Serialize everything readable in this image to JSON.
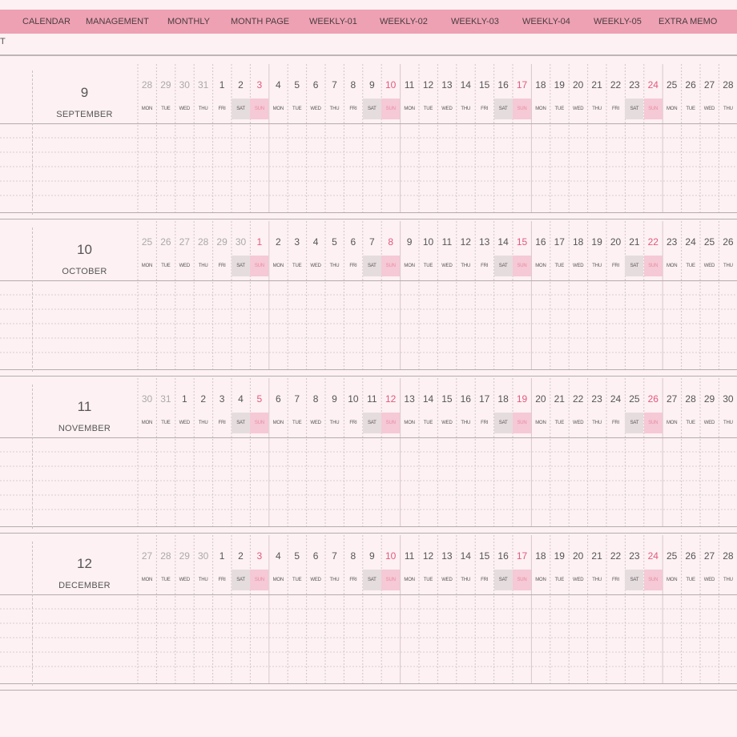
{
  "tabs": [
    {
      "id": "calendar",
      "label": "CALENDAR"
    },
    {
      "id": "management",
      "label": "MANAGEMENT"
    },
    {
      "id": "monthly",
      "label": "MONTHLY"
    },
    {
      "id": "month-page",
      "label": "MONTH PAGE"
    },
    {
      "id": "weekly-01",
      "label": "WEEKLY-01"
    },
    {
      "id": "weekly-02",
      "label": "WEEKLY-02"
    },
    {
      "id": "weekly-03",
      "label": "WEEKLY-03"
    },
    {
      "id": "weekly-04",
      "label": "WEEKLY-04"
    },
    {
      "id": "weekly-05",
      "label": "WEEKLY-05"
    },
    {
      "id": "extra-memo",
      "label": "EXTRA MEMO"
    }
  ],
  "stub_text": "T",
  "colors": {
    "tab_bar": "#eea1b3",
    "background": "#fdf1f3",
    "sunday": "#e3587d",
    "sat_fill": "#e5dcde",
    "sun_fill": "#f5c9d5"
  },
  "dow_labels": [
    "MON",
    "TUE",
    "WED",
    "THU",
    "FRI",
    "SAT",
    "SUN"
  ],
  "months": [
    {
      "number": "9",
      "name": "SEPTEMBER",
      "days": [
        "28",
        "29",
        "30",
        "31",
        "1",
        "2",
        "3",
        "4",
        "5",
        "6",
        "7",
        "8",
        "9",
        "10",
        "11",
        "12",
        "13",
        "14",
        "15",
        "16",
        "17",
        "18",
        "19",
        "20",
        "21",
        "22",
        "23",
        "24",
        "25",
        "26",
        "27",
        "28"
      ],
      "leading_out": 4
    },
    {
      "number": "10",
      "name": "OCTOBER",
      "days": [
        "25",
        "26",
        "27",
        "28",
        "29",
        "30",
        "1",
        "2",
        "3",
        "4",
        "5",
        "6",
        "7",
        "8",
        "9",
        "10",
        "11",
        "12",
        "13",
        "14",
        "15",
        "16",
        "17",
        "18",
        "19",
        "20",
        "21",
        "22",
        "23",
        "24",
        "25",
        "26"
      ],
      "leading_out": 6
    },
    {
      "number": "11",
      "name": "NOVEMBER",
      "days": [
        "30",
        "31",
        "1",
        "2",
        "3",
        "4",
        "5",
        "6",
        "7",
        "8",
        "9",
        "10",
        "11",
        "12",
        "13",
        "14",
        "15",
        "16",
        "17",
        "18",
        "19",
        "20",
        "21",
        "22",
        "23",
        "24",
        "25",
        "26",
        "27",
        "28",
        "29",
        "30"
      ],
      "leading_out": 2
    },
    {
      "number": "12",
      "name": "DECEMBER",
      "days": [
        "27",
        "28",
        "29",
        "30",
        "1",
        "2",
        "3",
        "4",
        "5",
        "6",
        "7",
        "8",
        "9",
        "10",
        "11",
        "12",
        "13",
        "14",
        "15",
        "16",
        "17",
        "18",
        "19",
        "20",
        "21",
        "22",
        "23",
        "24",
        "25",
        "26",
        "27",
        "28"
      ],
      "leading_out": 4
    }
  ]
}
